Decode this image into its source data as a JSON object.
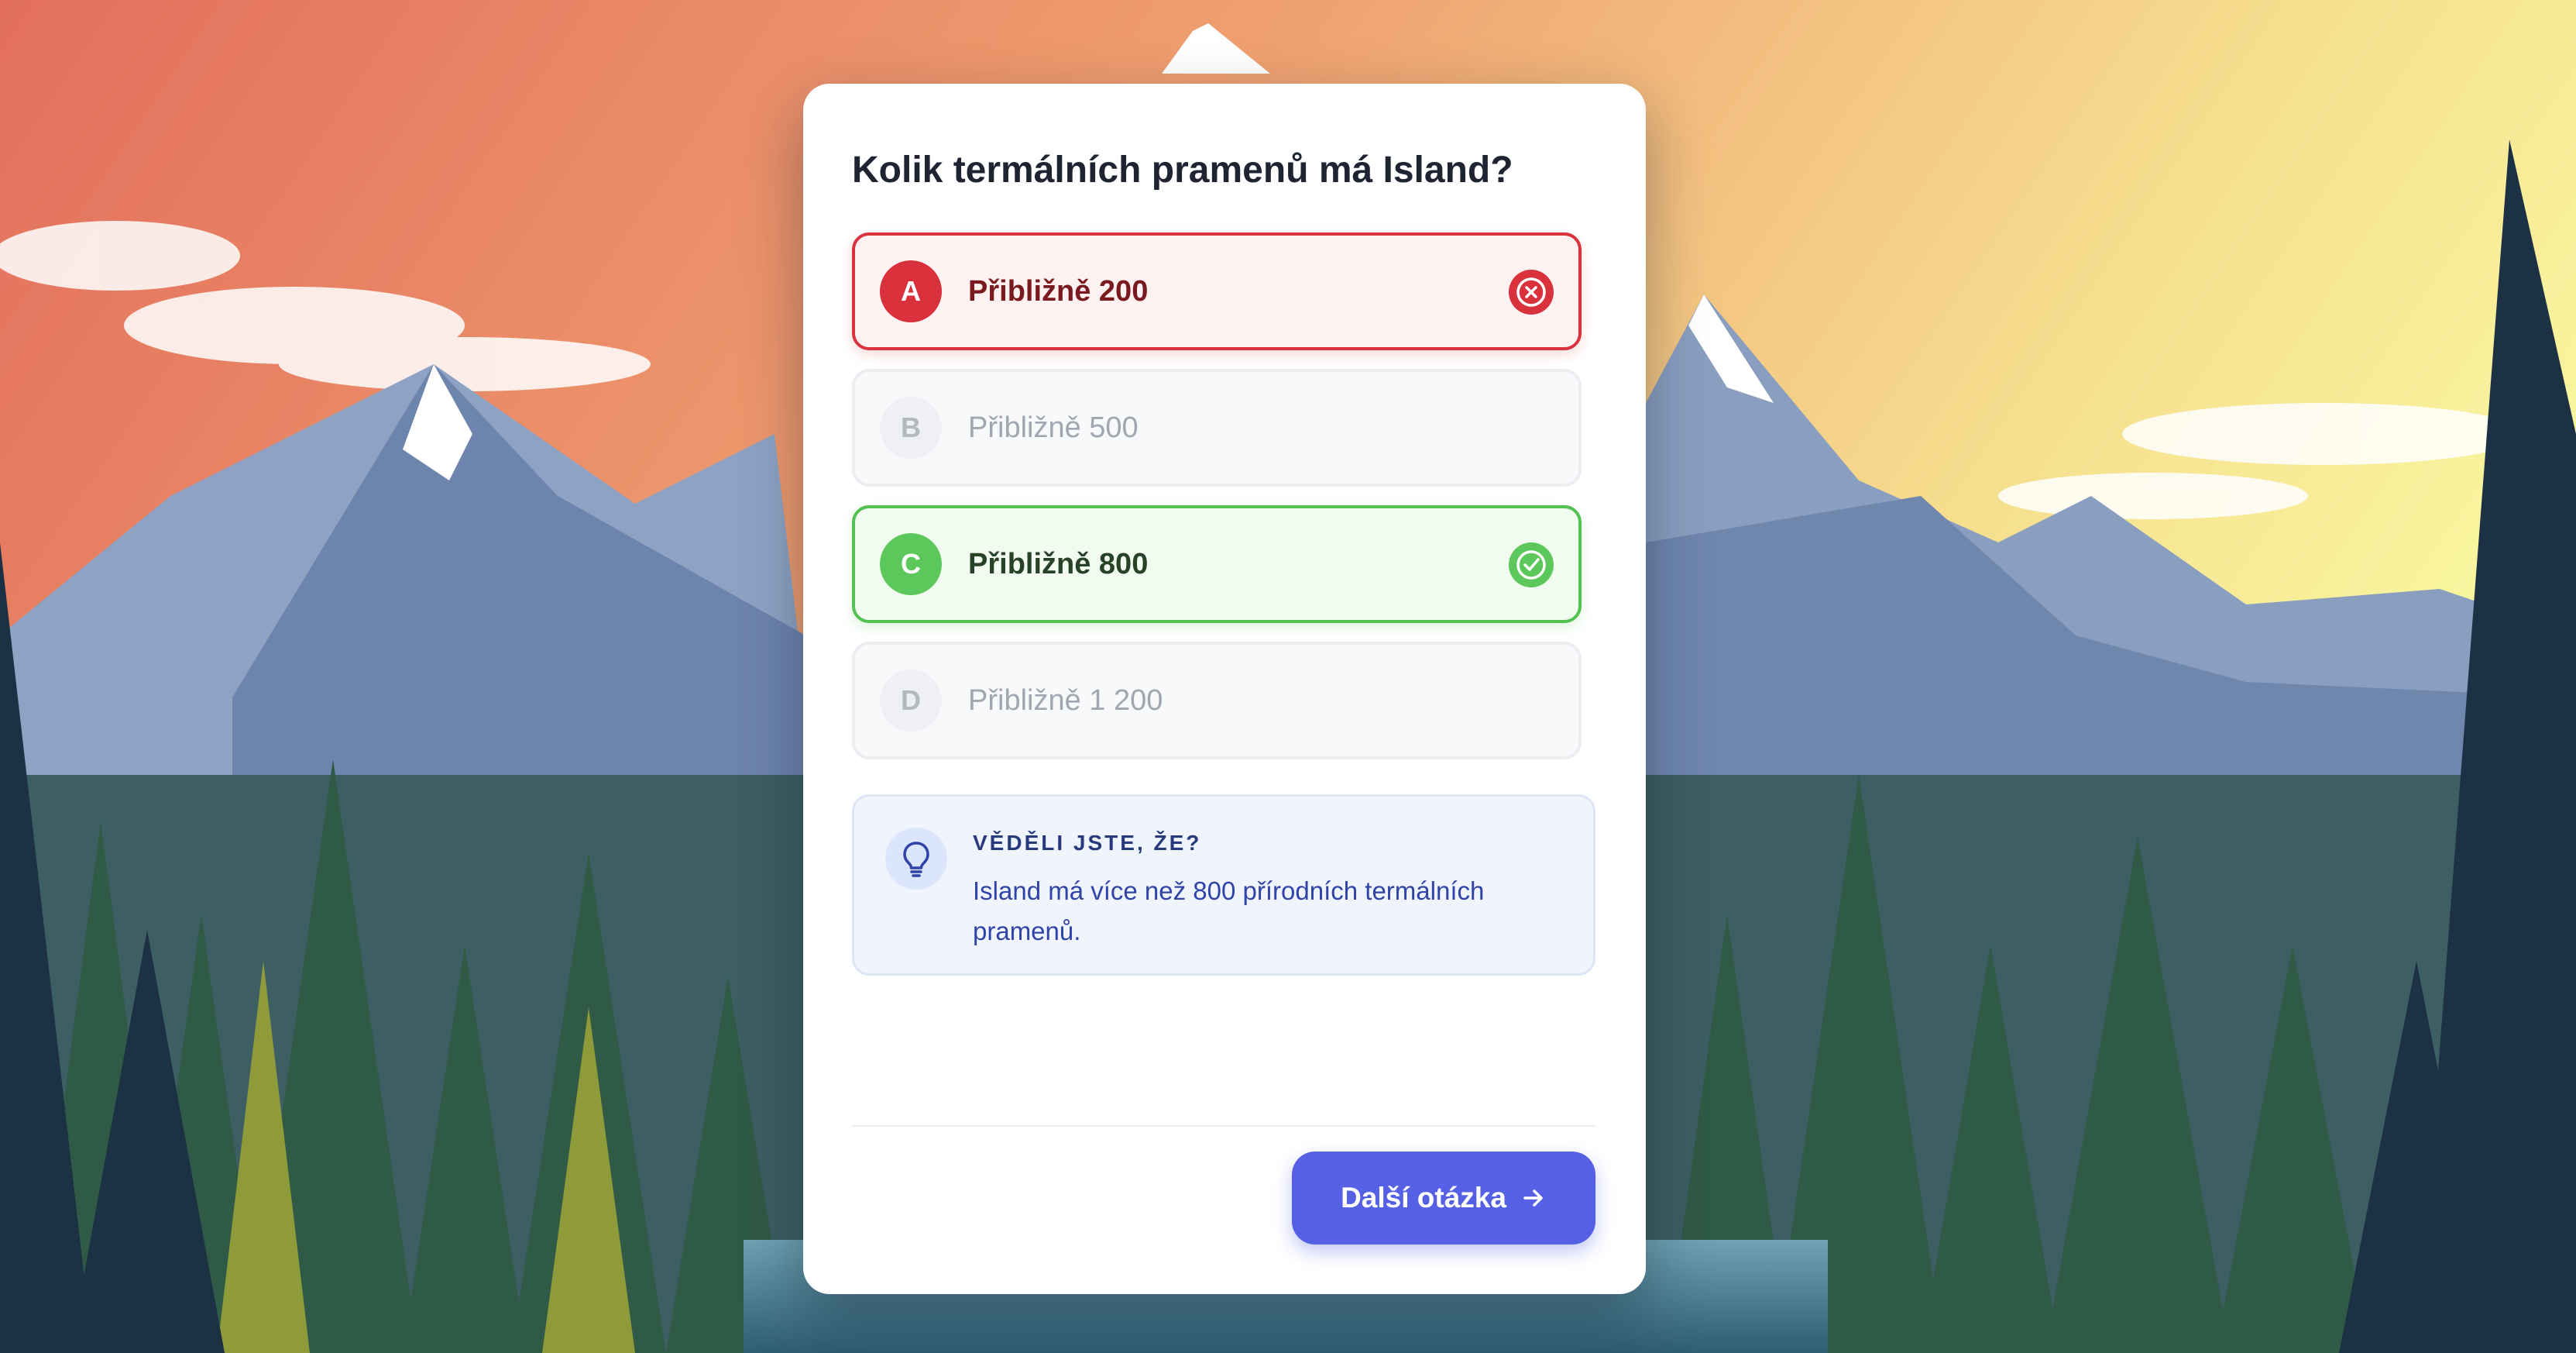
{
  "quiz": {
    "question": "Kolik termálních pramenů má Island?",
    "options": [
      {
        "letter": "A",
        "label": "Přibližně 200",
        "state": "wrong"
      },
      {
        "letter": "B",
        "label": "Přibližně 500",
        "state": "neutral"
      },
      {
        "letter": "C",
        "label": "Přibližně 800",
        "state": "correct"
      },
      {
        "letter": "D",
        "label": "Přibližně 1 200",
        "state": "neutral"
      }
    ],
    "fact": {
      "title": "VĚDĚLI JSTE, ŽE?",
      "text": "Island má více než 800 přírodních termálních pramenů.",
      "icon": "lightbulb-icon"
    },
    "next_label": "Další otázka",
    "next_icon": "arrow-right-icon"
  },
  "colors": {
    "wrong": "#d9323d",
    "correct": "#5cc85b",
    "accent": "#5660e4",
    "fact_text": "#3043a6"
  }
}
